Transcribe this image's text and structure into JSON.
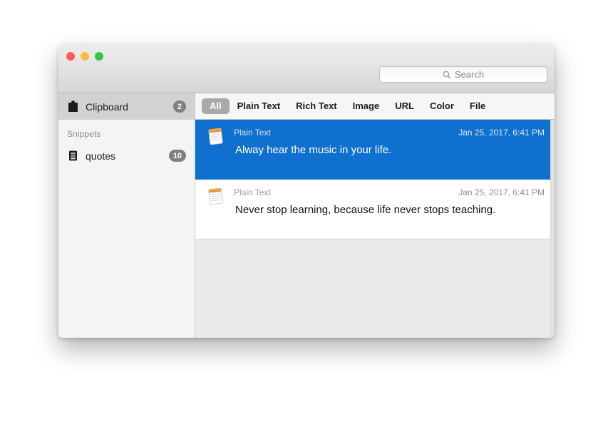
{
  "window": {
    "traffic_lights": [
      {
        "name": "close",
        "color": "#fc5b57"
      },
      {
        "name": "minimize",
        "color": "#fdbc40"
      },
      {
        "name": "zoom",
        "color": "#33c748"
      }
    ]
  },
  "search": {
    "placeholder": "Search",
    "value": ""
  },
  "sidebar": {
    "clipboard": {
      "label": "Clipboard",
      "badge": "2"
    },
    "snippets_header": "Snippets",
    "snippets": [
      {
        "label": "quotes",
        "badge": "10"
      }
    ]
  },
  "tabs": [
    {
      "label": "All",
      "active": true
    },
    {
      "label": "Plain Text",
      "active": false
    },
    {
      "label": "Rich Text",
      "active": false
    },
    {
      "label": "Image",
      "active": false
    },
    {
      "label": "URL",
      "active": false
    },
    {
      "label": "Color",
      "active": false
    },
    {
      "label": "File",
      "active": false
    }
  ],
  "items": [
    {
      "type": "Plain Text",
      "date": "Jan 25, 2017, 6:41 PM",
      "text": "Alway hear the music in your life.",
      "selected": true
    },
    {
      "type": "Plain Text",
      "date": "Jan 25, 2017, 6:41 PM",
      "text": "Never stop learning, because life never stops teaching.",
      "selected": false
    }
  ],
  "colors": {
    "selection_blue": "#1070d0",
    "badge_gray": "#808080",
    "active_tab_gray": "#a9a9a9"
  }
}
